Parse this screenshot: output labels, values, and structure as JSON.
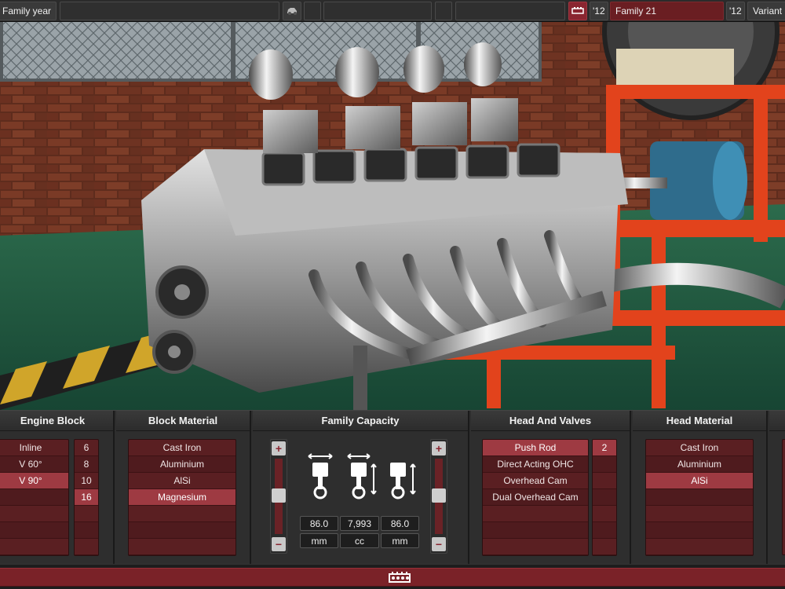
{
  "topbar": {
    "family_year_label": "Family year",
    "variant_year_value": "'12",
    "family_name_year": "'12",
    "family_name": "Family 21",
    "variant_label": "'12",
    "variant_name": "Variant "
  },
  "sections": {
    "engine_block": {
      "title": "Engine Block",
      "layouts": [
        "Inline",
        "V 60°",
        "V 90°",
        "",
        "",
        "",
        ""
      ],
      "cylinders": [
        "6",
        "8",
        "10",
        "16",
        "",
        "",
        ""
      ]
    },
    "block_material": {
      "title": "Block Material",
      "items": [
        "Cast Iron",
        "Aluminium",
        "AlSi",
        "Magnesium",
        "",
        "",
        ""
      ]
    },
    "family_capacity": {
      "title": "Family Capacity",
      "bore": "86.0",
      "displacement": "7,993",
      "stroke": "86.0",
      "bore_unit": "mm",
      "displacement_unit": "cc",
      "stroke_unit": "mm",
      "plus_symbol": "+",
      "minus_symbol": "−"
    },
    "head_valves": {
      "title": "Head And Valves",
      "items": [
        "Push Rod",
        "Direct Acting OHC",
        "Overhead Cam",
        "Dual Overhead Cam",
        "",
        "",
        ""
      ],
      "valves": [
        "2",
        "",
        "",
        "",
        "",
        "",
        ""
      ]
    },
    "head_material": {
      "title": "Head Material",
      "items": [
        "Cast Iron",
        "Aluminium",
        "AlSi",
        "",
        "",
        "",
        ""
      ]
    }
  },
  "colors": {
    "accent": "#9e3a42",
    "list_bg": "#5a1f22",
    "panel_bg": "#2e2e2e"
  },
  "icons": [
    "car-icon",
    "engine-icon",
    "piston-bore-icon",
    "piston-displacement-icon",
    "piston-stroke-icon"
  ]
}
